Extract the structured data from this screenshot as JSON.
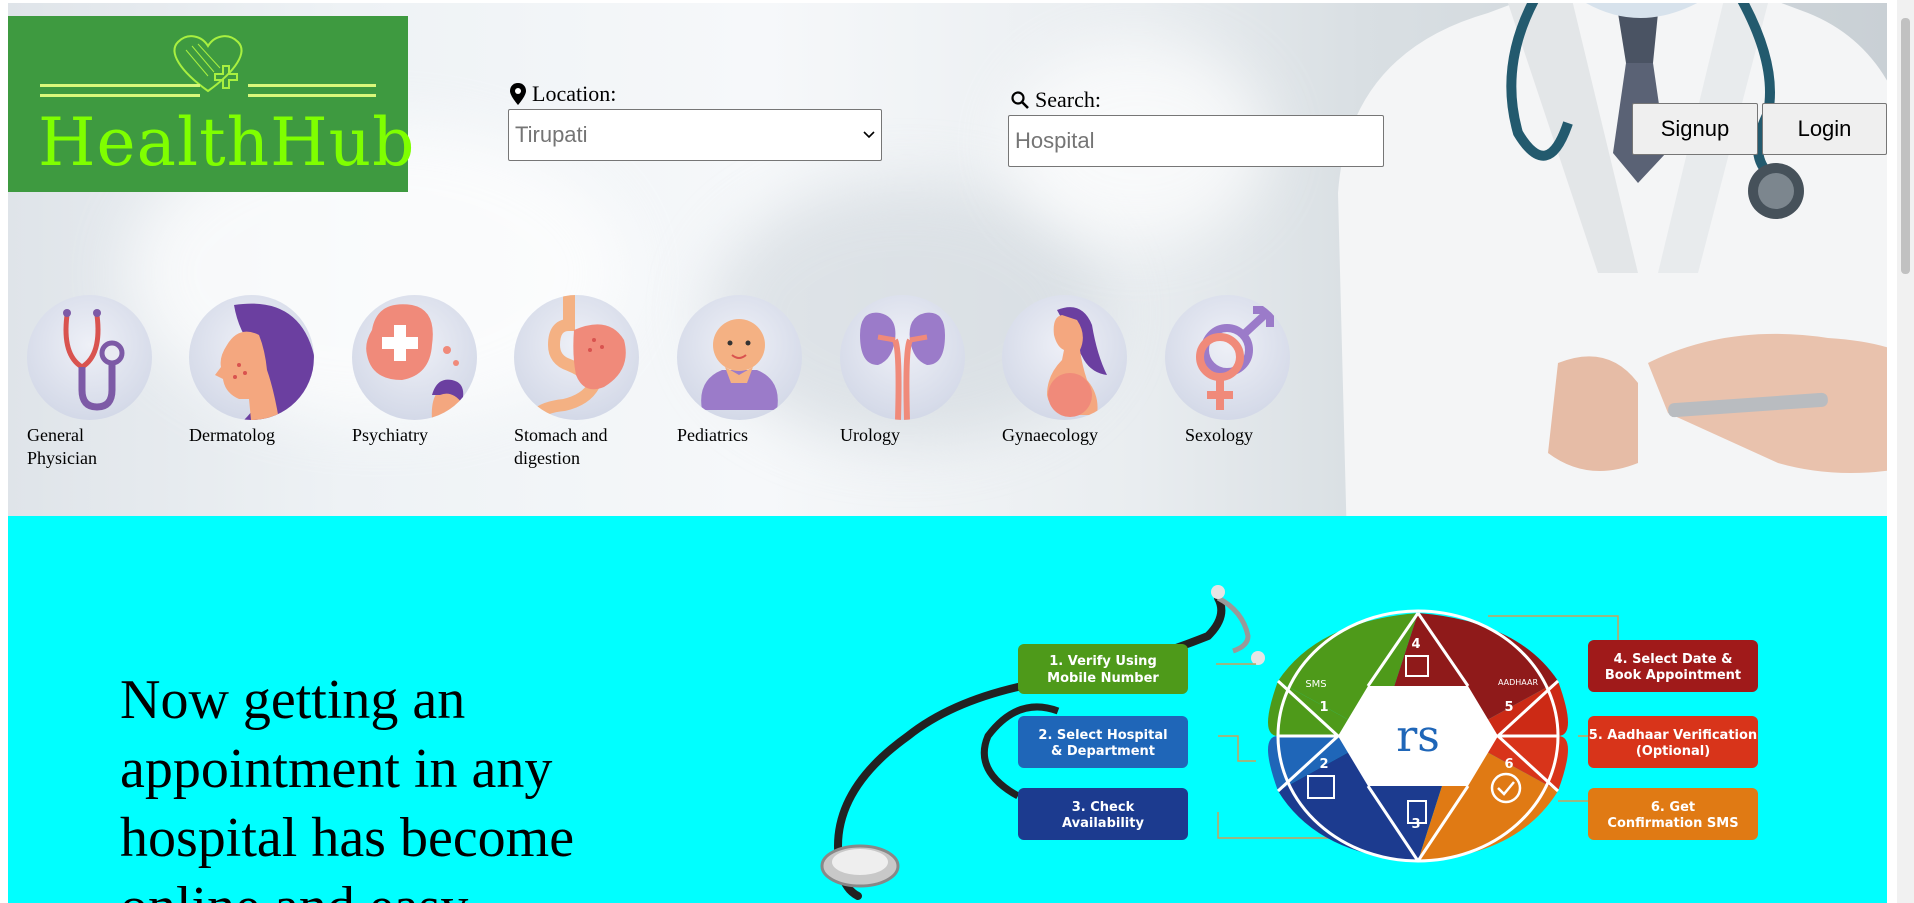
{
  "brand": {
    "name": "HealthHub",
    "logo_color": "#3e9a40",
    "text_color": "#7fff00"
  },
  "location": {
    "label": "Location:",
    "icon": "map-pin-icon",
    "selected": "Tirupati"
  },
  "search": {
    "label": "Search:",
    "icon": "magnifier-icon",
    "placeholder": "Hospital"
  },
  "auth": {
    "signup": "Signup",
    "login": "Login"
  },
  "specialties": [
    {
      "label": "General Physician",
      "icon": "stethoscope-icon"
    },
    {
      "label": "Dermatolog",
      "icon": "skin-face-icon"
    },
    {
      "label": "Psychiatry",
      "icon": "mental-health-icon"
    },
    {
      "label": "Stomach and digestion",
      "icon": "stomach-icon"
    },
    {
      "label": "Pediatrics",
      "icon": "baby-icon"
    },
    {
      "label": "Urology",
      "icon": "kidney-icon"
    },
    {
      "label": "Gynaecology",
      "icon": "pregnant-woman-icon"
    },
    {
      "label": "Sexology",
      "icon": "gender-symbols-icon"
    }
  ],
  "banner": {
    "headline": "Now getting an appointment in any hospital has become online and easy",
    "background": "#00ffff",
    "ors_logo": "rs",
    "steps": [
      {
        "text_lines": [
          "1. Verify Using",
          "Mobile Number"
        ],
        "number": "1",
        "color": "#4e9a1a"
      },
      {
        "text_lines": [
          "2. Select Hospital",
          "& Department"
        ],
        "number": "2",
        "color": "#1f66b8"
      },
      {
        "text_lines": [
          "3. Check",
          "Availability"
        ],
        "number": "3",
        "color": "#1c3b8f"
      },
      {
        "text_lines": [
          "4. Select Date &",
          "Book Appointment"
        ],
        "number": "4",
        "color": "#a01a1a"
      },
      {
        "text_lines": [
          "5. Aadhaar Verification",
          "(Optional)"
        ],
        "number": "5",
        "color": "#d8341a"
      },
      {
        "text_lines": [
          "6. Get",
          "Confirmation SMS"
        ],
        "number": "6",
        "color": "#e07a14"
      }
    ],
    "hexagon_labels": {
      "sms": "SMS",
      "aadhaar": "AADHAAR"
    }
  }
}
